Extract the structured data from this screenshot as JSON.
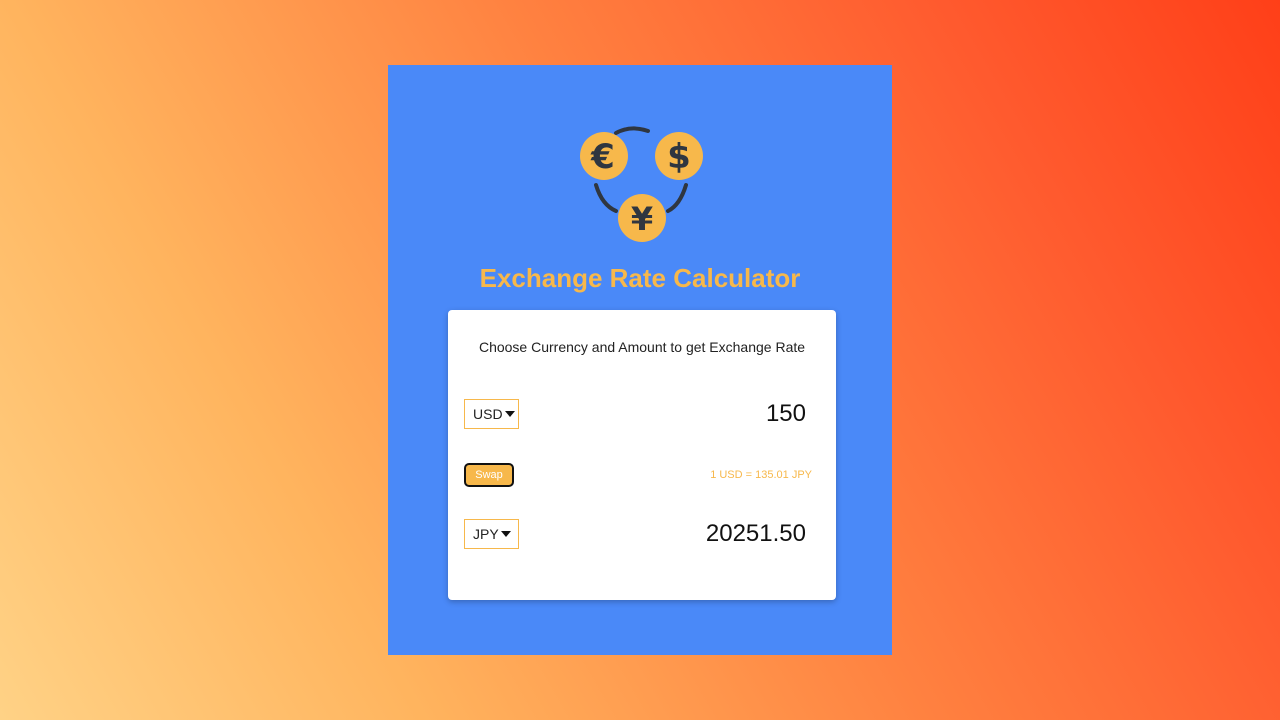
{
  "app": {
    "title": "Exchange Rate Calculator",
    "instructions": "Choose Currency and Amount to get Exchange Rate"
  },
  "currency_one": {
    "selected": "USD",
    "amount": "150"
  },
  "currency_two": {
    "selected": "JPY",
    "amount": "20251.50"
  },
  "swap": {
    "label": "Swap"
  },
  "rate": {
    "text": "1 USD = 135.01 JPY"
  },
  "logo": {
    "icons": [
      "euro-coin-icon",
      "dollar-coin-icon",
      "yen-coin-icon"
    ],
    "symbols": [
      "€",
      "$",
      "¥"
    ]
  },
  "colors": {
    "accent": "#f7b84b",
    "panel": "#4a89f8",
    "card": "#ffffff",
    "icon_dark": "#2f3640"
  }
}
